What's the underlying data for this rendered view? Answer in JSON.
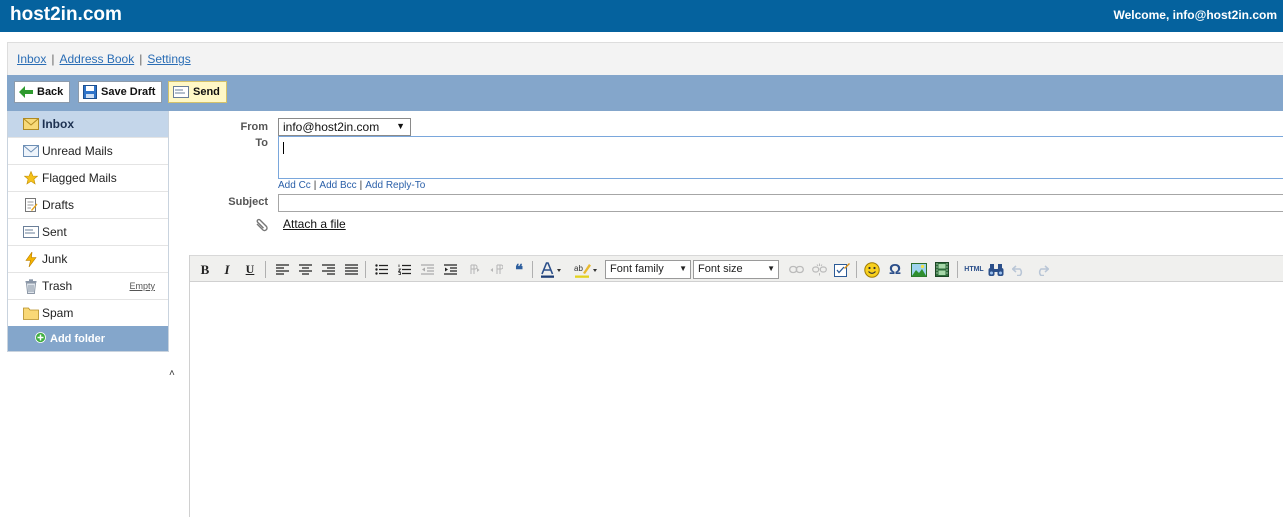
{
  "header": {
    "brand": "host2in.com",
    "welcome": "Welcome, info@host2in.com"
  },
  "nav": {
    "inbox": "Inbox",
    "address_book": "Address Book",
    "settings": "Settings",
    "separator": "|"
  },
  "toolbar": {
    "back": "Back",
    "save_draft": "Save Draft",
    "send": "Send"
  },
  "sidebar": {
    "folders": [
      {
        "label": "Inbox",
        "icon": "inbox-icon"
      },
      {
        "label": "Unread Mails",
        "icon": "envelope-icon"
      },
      {
        "label": "Flagged Mails",
        "icon": "star-icon"
      },
      {
        "label": "Drafts",
        "icon": "drafts-icon"
      },
      {
        "label": "Sent",
        "icon": "sent-icon"
      },
      {
        "label": "Junk",
        "icon": "lightning-icon"
      },
      {
        "label": "Trash",
        "icon": "trash-icon",
        "action": "Empty"
      },
      {
        "label": "Spam",
        "icon": "folder-icon"
      }
    ],
    "add_folder": "Add folder",
    "collapse_glyph": "˄"
  },
  "compose": {
    "from_label": "From",
    "from_value": "info@host2in.com",
    "to_label": "To",
    "add_cc": "Add Cc",
    "add_bcc": "Add Bcc",
    "add_reply_to": "Add Reply-To",
    "subject_label": "Subject",
    "attach": "Attach a file"
  },
  "editor": {
    "font_family": "Font family",
    "font_size": "Font size",
    "bold": "B",
    "italic": "I",
    "underline": "U",
    "blockquote": "❝",
    "special_char": "Ω",
    "html": "HTML"
  },
  "colors": {
    "topbar": "#05629e",
    "toolbar": "#84a6cb",
    "active_folder": "#c4d6ea",
    "link": "#2a6db5"
  }
}
